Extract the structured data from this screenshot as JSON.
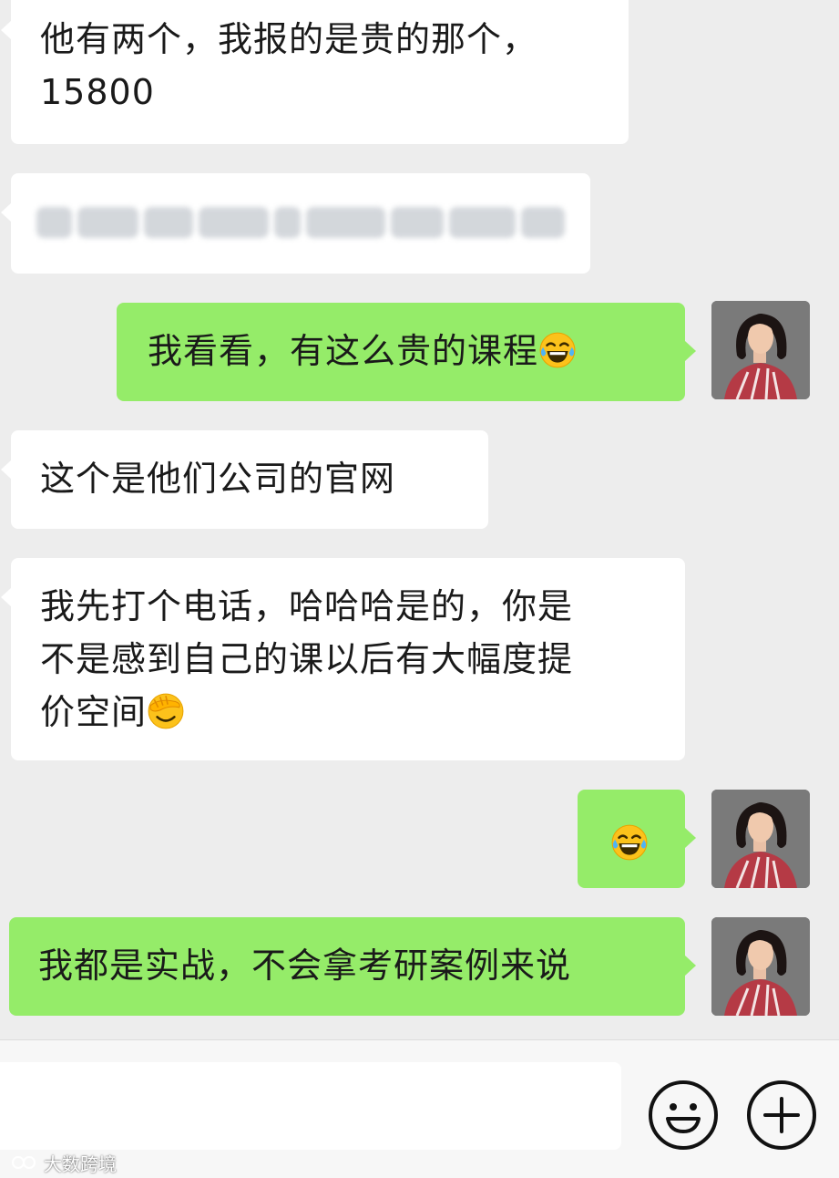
{
  "messages": [
    {
      "side": "in",
      "text": "他有两个，我报的是贵的那个，15800"
    },
    {
      "side": "in",
      "text": "",
      "blurred": true
    },
    {
      "side": "out",
      "text": "我看看，有这么贵的课程",
      "emoji": "tears-of-joy-emoji"
    },
    {
      "side": "in",
      "text": "这个是他们公司的官网"
    },
    {
      "side": "in",
      "text": "我先打个电话，哈哈哈是的，你是不是感到自己的课以后有大幅度提价空间",
      "emoji": "facepalm-emoji"
    },
    {
      "side": "out",
      "text": "",
      "emoji": "tears-of-joy-emoji"
    },
    {
      "side": "out",
      "text": "我都是实战，不会拿考研案例来说"
    }
  ],
  "msg0": {
    "line1": "他有两个，我报的是贵的那个，",
    "line2": "15800"
  },
  "msg4": {
    "line1": "我先打个电话，哈哈哈是的，你是",
    "line2": "不是感到自己的课以后有大幅度提",
    "line3": "价空间"
  },
  "input_bar": {
    "input_value": "",
    "emoji_icon": "smiley-icon",
    "plus_icon": "plus-icon"
  },
  "watermark": {
    "text": "大数跨境"
  },
  "colors": {
    "background": "#ededed",
    "incoming_bubble": "#ffffff",
    "outgoing_bubble": "#95ec69",
    "text": "#1a1a1a"
  }
}
